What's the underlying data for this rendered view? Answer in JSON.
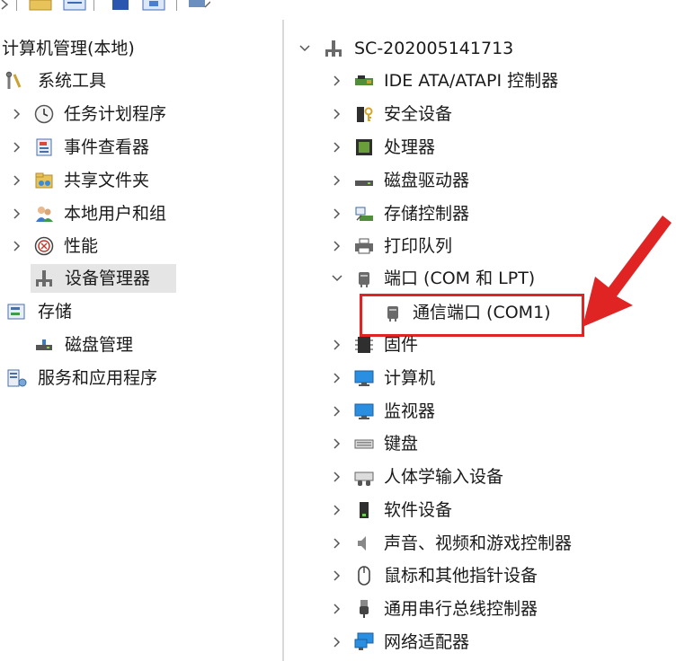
{
  "colors": {
    "accent_red": "#e02424",
    "selected_bg": "#e5e5e5",
    "chevron": "#555555"
  },
  "left_tree": {
    "root_label": "计算机管理(本地)",
    "system_tools_label": "系统工具",
    "task_scheduler_label": "任务计划程序",
    "event_viewer_label": "事件查看器",
    "shared_folders_label": "共享文件夹",
    "local_users_label": "本地用户和组",
    "performance_label": "性能",
    "device_manager_label": "设备管理器",
    "storage_label": "存储",
    "disk_management_label": "磁盘管理",
    "services_apps_label": "服务和应用程序"
  },
  "device_tree": {
    "computer_name": "SC-202005141713",
    "categories": [
      {
        "label": "IDE ATA/ATAPI 控制器",
        "icon": "ide-controller-icon"
      },
      {
        "label": "安全设备",
        "icon": "security-device-icon"
      },
      {
        "label": "处理器",
        "icon": "processor-icon"
      },
      {
        "label": "磁盘驱动器",
        "icon": "disk-drive-icon"
      },
      {
        "label": "存储控制器",
        "icon": "storage-controller-icon"
      },
      {
        "label": "打印队列",
        "icon": "printer-icon"
      },
      {
        "label": "端口 (COM 和 LPT)",
        "icon": "port-icon"
      },
      {
        "label": "固件",
        "icon": "firmware-icon"
      },
      {
        "label": "计算机",
        "icon": "computer-icon"
      },
      {
        "label": "监视器",
        "icon": "monitor-icon"
      },
      {
        "label": "键盘",
        "icon": "keyboard-icon"
      },
      {
        "label": "人体学输入设备",
        "icon": "hid-icon"
      },
      {
        "label": "软件设备",
        "icon": "software-device-icon"
      },
      {
        "label": "声音、视频和游戏控制器",
        "icon": "speaker-icon"
      },
      {
        "label": "鼠标和其他指针设备",
        "icon": "mouse-icon"
      },
      {
        "label": "通用串行总线控制器",
        "icon": "usb-icon"
      },
      {
        "label": "网络适配器",
        "icon": "network-adapter-icon"
      }
    ],
    "port_child_label": "通信端口 (COM1)"
  }
}
